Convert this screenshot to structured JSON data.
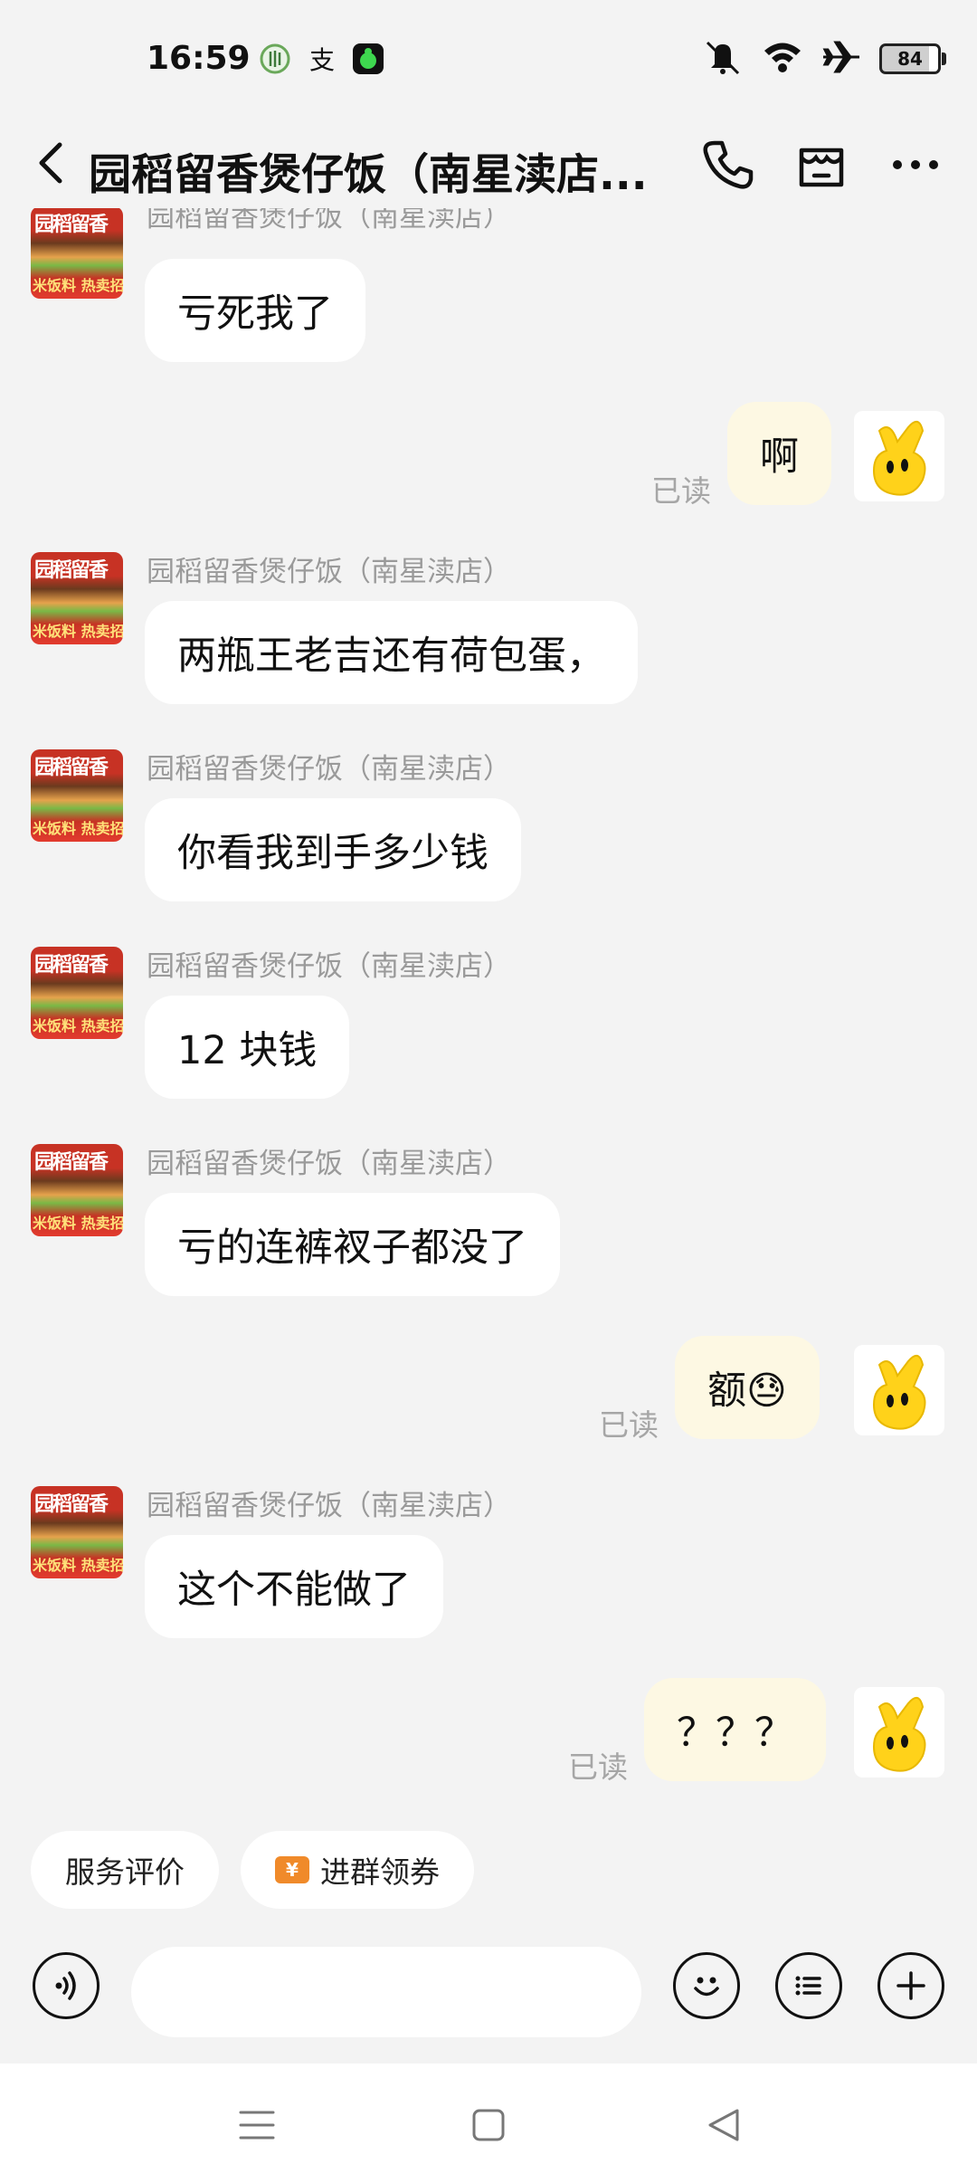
{
  "status_bar": {
    "time": "16:59",
    "battery": "84"
  },
  "header": {
    "title": "园稻留香煲仔饭（南星渎店..."
  },
  "shop_avatar": {
    "top_text": "园稻留香",
    "bottom_text": "米饭料 热卖招牌"
  },
  "messages": [
    {
      "side": "left",
      "sender": "园稻留香煲仔饭（南星渎店）",
      "text": "亏死我了"
    },
    {
      "side": "right",
      "text": "啊",
      "status": "已读"
    },
    {
      "side": "left",
      "sender": "园稻留香煲仔饭（南星渎店）",
      "text": "两瓶王老吉还有荷包蛋，"
    },
    {
      "side": "left",
      "sender": "园稻留香煲仔饭（南星渎店）",
      "text": "你看我到手多少钱"
    },
    {
      "side": "left",
      "sender": "园稻留香煲仔饭（南星渎店）",
      "text": "12 块钱"
    },
    {
      "side": "left",
      "sender": "园稻留香煲仔饭（南星渎店）",
      "text": "亏的连裤衩子都没了"
    },
    {
      "side": "right",
      "text": "额😓",
      "status": "已读"
    },
    {
      "side": "left",
      "sender": "园稻留香煲仔饭（南星渎店）",
      "text": "这个不能做了"
    },
    {
      "side": "right",
      "text": "？？？",
      "status": "已读"
    }
  ],
  "quick_actions": {
    "rate": "服务评价",
    "coupon": "进群领券",
    "coupon_badge": "¥"
  },
  "input": {
    "placeholder": ""
  },
  "icons": {
    "back": "back-arrow-icon",
    "phone": "phone-icon",
    "store": "store-icon",
    "more": "more-icon",
    "voice": "voice-icon",
    "emoji": "emoji-icon",
    "list": "list-icon",
    "plus": "plus-icon"
  }
}
